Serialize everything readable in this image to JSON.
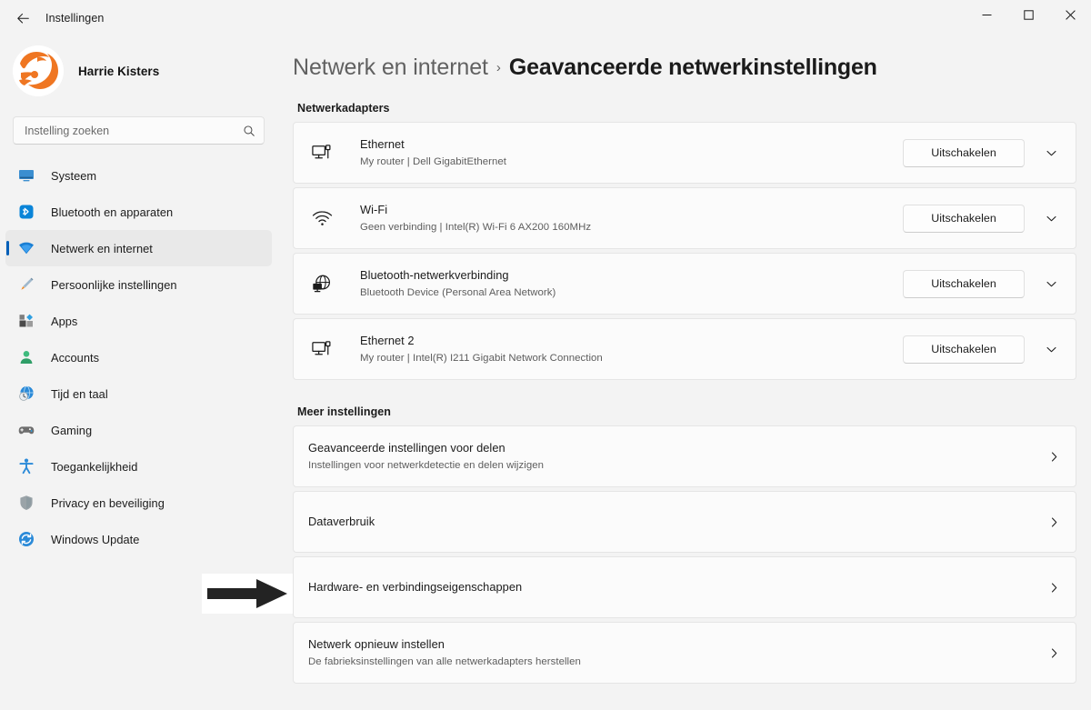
{
  "window": {
    "title": "Instellingen",
    "back_label": "Terug",
    "controls": {
      "minimize": "Minimaliseren",
      "maximize": "Maximaliseren",
      "close": "Sluiten"
    }
  },
  "sidebar": {
    "profile": {
      "name": "Harrie Kisters"
    },
    "search": {
      "placeholder": "Instelling zoeken",
      "value": ""
    },
    "items": [
      {
        "label": "Systeem",
        "icon": "system-icon",
        "selected": false
      },
      {
        "label": "Bluetooth en apparaten",
        "icon": "bluetooth-icon",
        "selected": false
      },
      {
        "label": "Netwerk en internet",
        "icon": "network-icon",
        "selected": true
      },
      {
        "label": "Persoonlijke instellingen",
        "icon": "personalization-icon",
        "selected": false
      },
      {
        "label": "Apps",
        "icon": "apps-icon",
        "selected": false
      },
      {
        "label": "Accounts",
        "icon": "accounts-icon",
        "selected": false
      },
      {
        "label": "Tijd en taal",
        "icon": "time-language-icon",
        "selected": false
      },
      {
        "label": "Gaming",
        "icon": "gaming-icon",
        "selected": false
      },
      {
        "label": "Toegankelijkheid",
        "icon": "accessibility-icon",
        "selected": false
      },
      {
        "label": "Privacy en beveiliging",
        "icon": "privacy-shield-icon",
        "selected": false
      },
      {
        "label": "Windows Update",
        "icon": "windows-update-icon",
        "selected": false
      }
    ]
  },
  "main": {
    "breadcrumb": {
      "parent": "Netwerk en internet",
      "separator": "›",
      "current": "Geavanceerde netwerkinstellingen"
    },
    "adapters_section": {
      "title": "Netwerkadapters",
      "items": [
        {
          "name": "Ethernet",
          "detail": "My router | Dell GigabitEthernet",
          "icon": "ethernet-icon",
          "button": "Uitschakelen"
        },
        {
          "name": "Wi-Fi",
          "detail": "Geen verbinding | Intel(R) Wi-Fi 6 AX200 160MHz",
          "icon": "wifi-icon",
          "button": "Uitschakelen"
        },
        {
          "name": "Bluetooth-netwerkverbinding",
          "detail": "Bluetooth Device (Personal Area Network)",
          "icon": "bluetooth-network-icon",
          "button": "Uitschakelen"
        },
        {
          "name": "Ethernet 2",
          "detail": "My router | Intel(R) I211 Gigabit Network Connection",
          "icon": "ethernet-icon",
          "button": "Uitschakelen"
        }
      ]
    },
    "more_section": {
      "title": "Meer instellingen",
      "items": [
        {
          "name": "Geavanceerde instellingen voor delen",
          "detail": "Instellingen voor netwerkdetectie en delen wijzigen"
        },
        {
          "name": "Dataverbruik",
          "detail": ""
        },
        {
          "name": "Hardware- en verbindingseigenschappen",
          "detail": ""
        },
        {
          "name": "Netwerk opnieuw instellen",
          "detail": "De fabrieksinstellingen van alle netwerkadapters herstellen"
        }
      ]
    }
  },
  "annotation": {
    "arrow": "right-arrow-annotation",
    "points_to": "Hardware- en verbindingseigenschappen"
  },
  "colors": {
    "accent": "#005fb8",
    "window_background": "#f3f3f3",
    "card_background": "#fbfbfb",
    "avatar_orange": "#ef7622"
  }
}
